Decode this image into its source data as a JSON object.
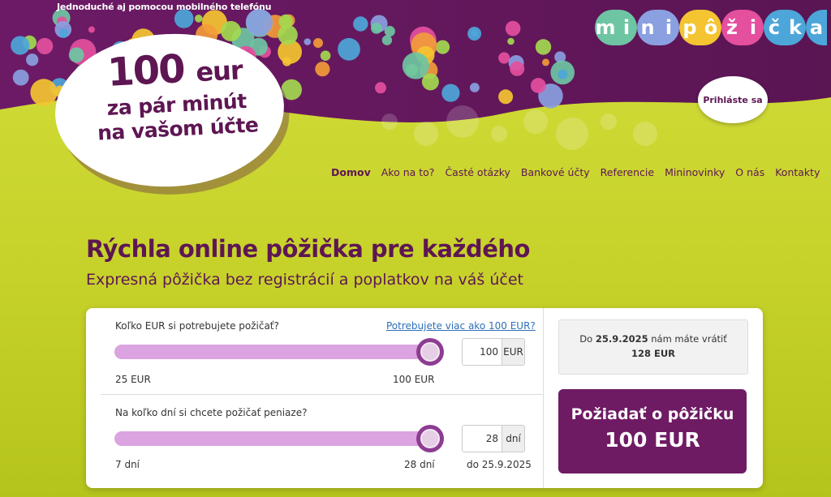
{
  "header": {
    "tagline": "Jednoduché aj pomocou mobilného telefónu",
    "logo_letters": [
      "m",
      "i",
      "n",
      "i",
      "p",
      "ô",
      "ž",
      "i",
      "č",
      "k",
      "a"
    ],
    "logo_colors": [
      "#6ec5a3",
      "#6ec5a3",
      "#8aa0e0",
      "#8aa0e0",
      "#f4c431",
      "#f4c431",
      "#e44f9e",
      "#e44f9e",
      "#4da6d9",
      "#4da6d9",
      "#4da6d9"
    ],
    "login": "Prihláste sa"
  },
  "promo": {
    "amount": "100",
    "unit": "eur",
    "line2": "za pár minút",
    "line3": "na vašom účte"
  },
  "nav": [
    "Domov",
    "Ako na to?",
    "Časté otázky",
    "Bankové účty",
    "Referencie",
    "Mininovinky",
    "O nás",
    "Kontakty"
  ],
  "headline": "Rýchla online pôžička pre každého",
  "subheadline": "Expresná pôžička bez registrácií a poplatkov na váš účet",
  "calculator": {
    "amount": {
      "question": "Koľko EUR si potrebujete požičať?",
      "more_link": "Potrebujete viac ako 100 EUR?",
      "value": "100",
      "unit": "EUR",
      "min_label": "25 EUR",
      "max_label": "100 EUR",
      "min": 25,
      "max": 100,
      "current": 100
    },
    "days": {
      "question": "Na koľko dní si chcete požičať peniaze?",
      "value": "28",
      "unit": "dní",
      "min_label": "7 dní",
      "max_label": "28 dní",
      "until": "do 25.9.2025",
      "min": 7,
      "max": 28,
      "current": 28
    }
  },
  "summary": {
    "line1_prefix": "Do ",
    "date": "25.9.2025",
    "line1_suffix": " nám máte vrátiť",
    "total": "128 EUR"
  },
  "cta": {
    "line1": "Požiadať o pôžičku",
    "line2": "100 EUR"
  },
  "colors": {
    "primary": "#5e1653",
    "accent_green": "#c6d22a",
    "slider": "#dba3e0",
    "cta": "#6e1b64"
  }
}
